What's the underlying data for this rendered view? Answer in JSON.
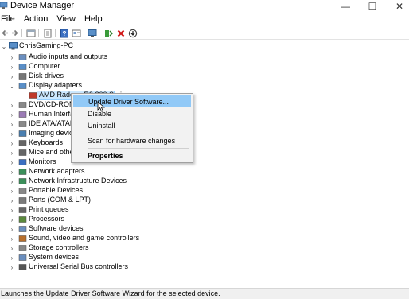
{
  "window": {
    "title": "Device Manager",
    "minimize_glyph": "—",
    "maximize_glyph": "☐",
    "close_glyph": "✕"
  },
  "menu": [
    "File",
    "Action",
    "View",
    "Help"
  ],
  "toolbar": {
    "icons": [
      "back-icon",
      "forward-icon",
      "properties-pane-icon",
      "show-hide-icon",
      "help-icon",
      "computer-properties-icon",
      "scan-hardware-icon",
      "update-driver-icon",
      "uninstall-icon",
      "disable-icon"
    ]
  },
  "tree": {
    "root": "ChrisGaming-PC",
    "items": [
      {
        "label": "Audio inputs and outputs",
        "expanded": false
      },
      {
        "label": "Computer",
        "expanded": false
      },
      {
        "label": "Disk drives",
        "expanded": false
      },
      {
        "label": "Display adapters",
        "expanded": true
      },
      {
        "label": "AMD Radeon R9 200 Series",
        "child": true,
        "selected": true
      },
      {
        "label": "DVD/CD-ROM drives",
        "expanded": false
      },
      {
        "label": "Human Interface Devices",
        "expanded": false
      },
      {
        "label": "IDE ATA/ATAPI controllers",
        "expanded": false
      },
      {
        "label": "Imaging devices",
        "expanded": false
      },
      {
        "label": "Keyboards",
        "expanded": false
      },
      {
        "label": "Mice and other pointing devices",
        "expanded": false
      },
      {
        "label": "Monitors",
        "expanded": false
      },
      {
        "label": "Network adapters",
        "expanded": false
      },
      {
        "label": "Network Infrastructure Devices",
        "expanded": false
      },
      {
        "label": "Portable Devices",
        "expanded": false
      },
      {
        "label": "Ports (COM & LPT)",
        "expanded": false
      },
      {
        "label": "Print queues",
        "expanded": false
      },
      {
        "label": "Processors",
        "expanded": false
      },
      {
        "label": "Software devices",
        "expanded": false
      },
      {
        "label": "Sound, video and game controllers",
        "expanded": false
      },
      {
        "label": "Storage controllers",
        "expanded": false
      },
      {
        "label": "System devices",
        "expanded": false
      },
      {
        "label": "Universal Serial Bus controllers",
        "expanded": false
      }
    ]
  },
  "context_menu": {
    "update": "Update Driver Software...",
    "disable": "Disable",
    "uninstall": "Uninstall",
    "scan": "Scan for hardware changes",
    "properties": "Properties"
  },
  "status": "Launches the Update Driver Software Wizard for the selected device.",
  "colors": {
    "selection": "#cce8ff",
    "menu_highlight": "#91c9f7",
    "statusbar": "#f0f0f0"
  }
}
